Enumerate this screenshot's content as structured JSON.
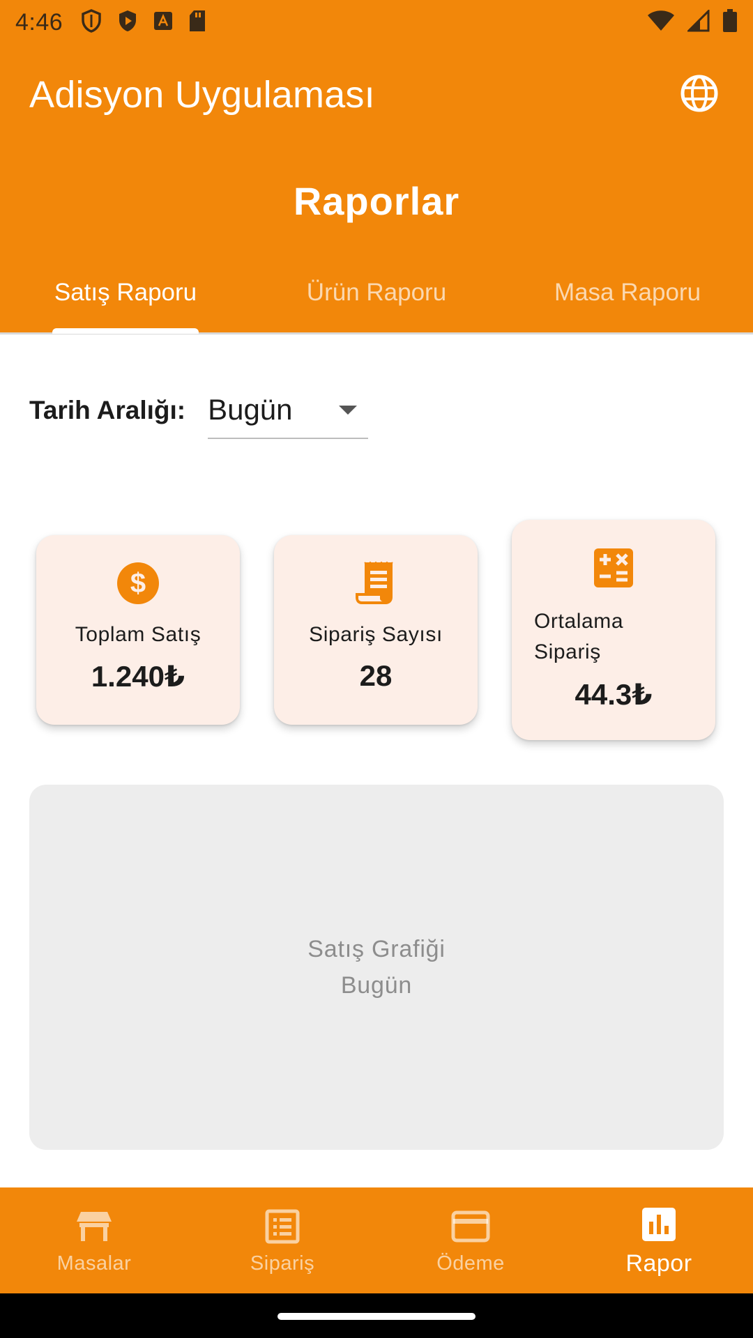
{
  "status_bar": {
    "time": "4:46"
  },
  "app_bar": {
    "title": "Adisyon Uygulaması"
  },
  "page": {
    "title": "Raporlar"
  },
  "tabs": [
    {
      "label": "Satış Raporu",
      "active": true
    },
    {
      "label": "Ürün Raporu",
      "active": false
    },
    {
      "label": "Masa Raporu",
      "active": false
    }
  ],
  "date_range": {
    "label": "Tarih Aralığı:",
    "value": "Bugün"
  },
  "stats": [
    {
      "icon": "dollar-circle-icon",
      "label": "Toplam Satış",
      "value": "1.240₺"
    },
    {
      "icon": "receipt-icon",
      "label": "Sipariş Sayısı",
      "value": "28"
    },
    {
      "icon": "calculator-icon",
      "label": "Ortalama\nSipariş",
      "value": "44.3₺"
    }
  ],
  "chart_placeholder": {
    "line1": "Satış Grafiği",
    "line2": "Bugün"
  },
  "bottom_nav": [
    {
      "icon": "table-icon",
      "label": "Masalar",
      "active": false
    },
    {
      "icon": "order-list-icon",
      "label": "Sipariş",
      "active": false
    },
    {
      "icon": "credit-card-icon",
      "label": "Ödeme",
      "active": false
    },
    {
      "icon": "bar-chart-icon",
      "label": "Rapor",
      "active": true
    }
  ],
  "colors": {
    "primary": "#F2870A",
    "card_background": "#FDEEE7",
    "chart_background": "#EDEDED"
  }
}
